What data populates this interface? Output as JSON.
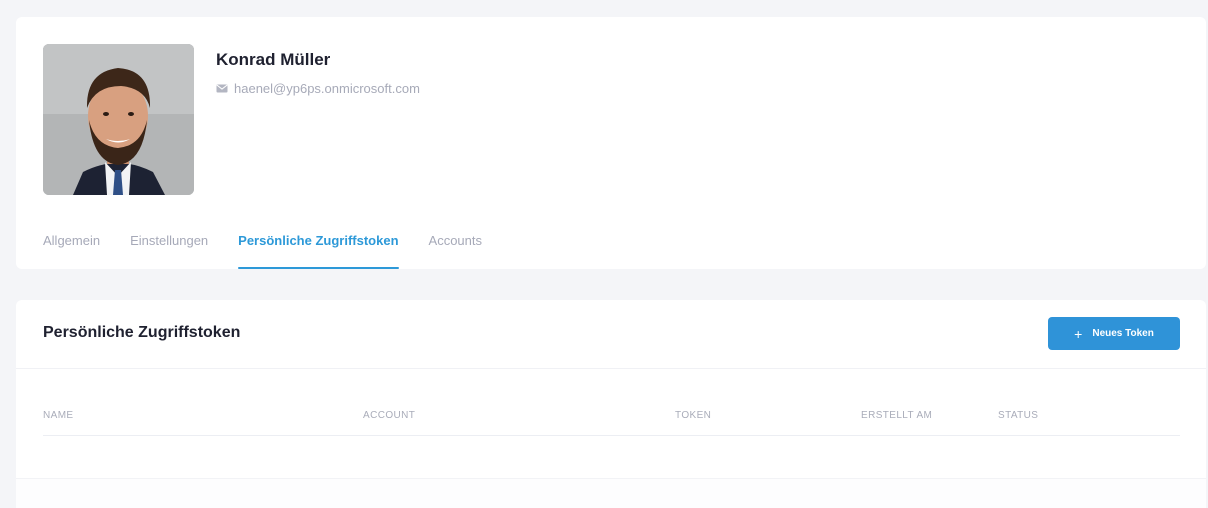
{
  "profile": {
    "name": "Konrad Müller",
    "email": "haenel@yp6ps.onmicrosoft.com"
  },
  "tabs": [
    {
      "label": "Allgemein",
      "active": false
    },
    {
      "label": "Einstellungen",
      "active": false
    },
    {
      "label": "Persönliche Zugriffstoken",
      "active": true
    },
    {
      "label": "Accounts",
      "active": false
    }
  ],
  "tokens": {
    "title": "Persönliche Zugriffstoken",
    "new_button_label": "Neues Token",
    "columns": [
      "Name",
      "Account",
      "Token",
      "Erstellt am",
      "Status"
    ],
    "rows": []
  },
  "colors": {
    "accent": "#2d99d8",
    "button": "#2f93d8",
    "background": "#f4f5f8"
  },
  "icons": {
    "email": "mail-icon",
    "new_token": "plus-icon"
  }
}
